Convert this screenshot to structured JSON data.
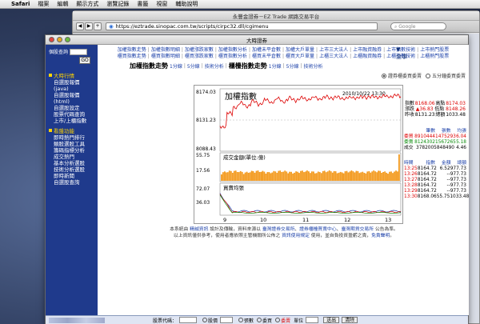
{
  "menubar": {
    "app": "Safari",
    "items": [
      "檔案",
      "編輯",
      "顯示方式",
      "瀏覽記錄",
      "書籤",
      "視窗",
      "輔助說明"
    ]
  },
  "browser": {
    "title": "永豐金證券－EZ Trade 網路交易平台",
    "url": "https://eztrade.sinopac.com.tw/scripts/cirpc32.dll/cgimenu",
    "search_placeholder": "Google"
  },
  "popup": {
    "title": "大時證券"
  },
  "leftnav": {
    "quote_label": "個股查詢",
    "go_label": "GO",
    "sections": [
      {
        "head": "大時行情",
        "items": [
          "自選股報價(java)",
          "自選股報價(html)",
          "自選股設定",
          "股票代碼查詢",
          "上市/上櫃指數"
        ]
      },
      {
        "head": "看盤功能",
        "items": [
          "即時熱門排行",
          "類股選股工具",
          "籌碼指標分析",
          "成交熱門",
          "基本分析選股",
          "技術分析選股",
          "即時新聞",
          "自選股查詢"
        ]
      }
    ]
  },
  "toplinks": {
    "row1": [
      "加權指數走勢",
      "加權指數明細",
      "加權漲跌家數",
      "加權指數分析",
      "加權未平倉數",
      "加權大戶單量",
      "上市三大法人",
      "上市融資融券",
      "上市指數技術",
      "上市熱門股票"
    ],
    "row2": [
      "櫃買指數走勢",
      "櫃買指數明細",
      "櫃買漲跌家數",
      "櫃買指數分析",
      "櫃買未平倉數",
      "櫃買大戶單量",
      "上櫃三大法人",
      "上櫃融資融券",
      "上櫃指數技術",
      "上櫃熱門股票"
    ]
  },
  "headline": {
    "t1": "加權指數走勢",
    "l1": "1分線",
    "l2": "5分線",
    "l3": "技術分析",
    "t2": "櫃檯指數走勢",
    "l4": "1分線",
    "l5": "5分線",
    "l6": "技術分析"
  },
  "radios": {
    "opt1": "證券櫃委買委賣",
    "opt2": "五分鐘委買委賣"
  },
  "chart_data": {
    "type": "line",
    "title": "加權指數",
    "timestamp": "2010/10/22 13:30",
    "y_ticks_main": [
      "8174.03",
      "8131.23",
      "8088.43"
    ],
    "panel2_label": "成交金額(單位:億)",
    "y_ticks_vol": [
      "55.75",
      "17.56"
    ],
    "panel3_label": "買賣均張",
    "y_ticks_bs": [
      "72.07",
      "36.03"
    ],
    "x_ticks": [
      "9",
      "10",
      "11",
      "12",
      "13"
    ],
    "ylim": [
      8088.43,
      8174.03
    ]
  },
  "quote": {
    "index_label": "指數",
    "index_value": "8168.06",
    "high_label": "高點",
    "high_value": "8174.03",
    "change_label": "漲跌",
    "change_value": "▲36.83",
    "low_label": "低點",
    "low_value": "8148.26",
    "prev_label": "昨收",
    "prev_value": "8131.23",
    "amount_label": "總額",
    "amount_value": "1033.48",
    "hdr_pen": "筆數",
    "hdr_zhang": "張數",
    "hdr_avg": "均張",
    "buy_label": "委買",
    "buy_pen": "8910444",
    "buy_zhang": "1475293",
    "buy_avg": "6.04",
    "sell_label": "委賣",
    "sell_pen": "8124302",
    "sell_zhang": "1567265",
    "sell_avg": "5.18",
    "deal_label": "成交",
    "deal_pen": "3782005",
    "deal_zhang": "848490",
    "deal_avg": "4.46"
  },
  "ticks": {
    "headers": [
      "時間",
      "指數",
      "金額",
      "總額"
    ],
    "rows": [
      [
        "13:25",
        "8164.72",
        "6.52",
        "977.73"
      ],
      [
        "13:26",
        "8164.72",
        "--",
        "977.73"
      ],
      [
        "13:27",
        "8164.72",
        "--",
        "977.73"
      ],
      [
        "13:28",
        "8164.72",
        "--",
        "977.73"
      ],
      [
        "13:29",
        "8164.72",
        "--",
        "977.73"
      ],
      [
        "13:30",
        "8168.06",
        "55.75",
        "1033.48"
      ]
    ]
  },
  "notes": {
    "l1a": "本系統由 ",
    "l1b": "精誠資訊",
    "l1c": " 設計及傳輸，資料來源以 ",
    "l1d": "臺灣證券交易所",
    "l1e": "、",
    "l1f": "證券櫃檯買賣中心",
    "l1g": "、",
    "l1h": "臺灣期貨交易所",
    "l1i": " 公告為準。",
    "l2a": "以上資訊僅供參考，使用者應依照主管機關所公佈之 ",
    "l2b": "資訊使用規定",
    "l2c": " 使用，並自負投資盈虧之責，",
    "l2d": "免責聲明",
    "l2e": "。"
  },
  "bottombar": {
    "code_label": "股票代碼：",
    "r1": "股價",
    "r2": "張數",
    "r3": "委買",
    "r4": "委賣",
    "unit_label": "單位",
    "send": "送出",
    "clear": "清除"
  }
}
